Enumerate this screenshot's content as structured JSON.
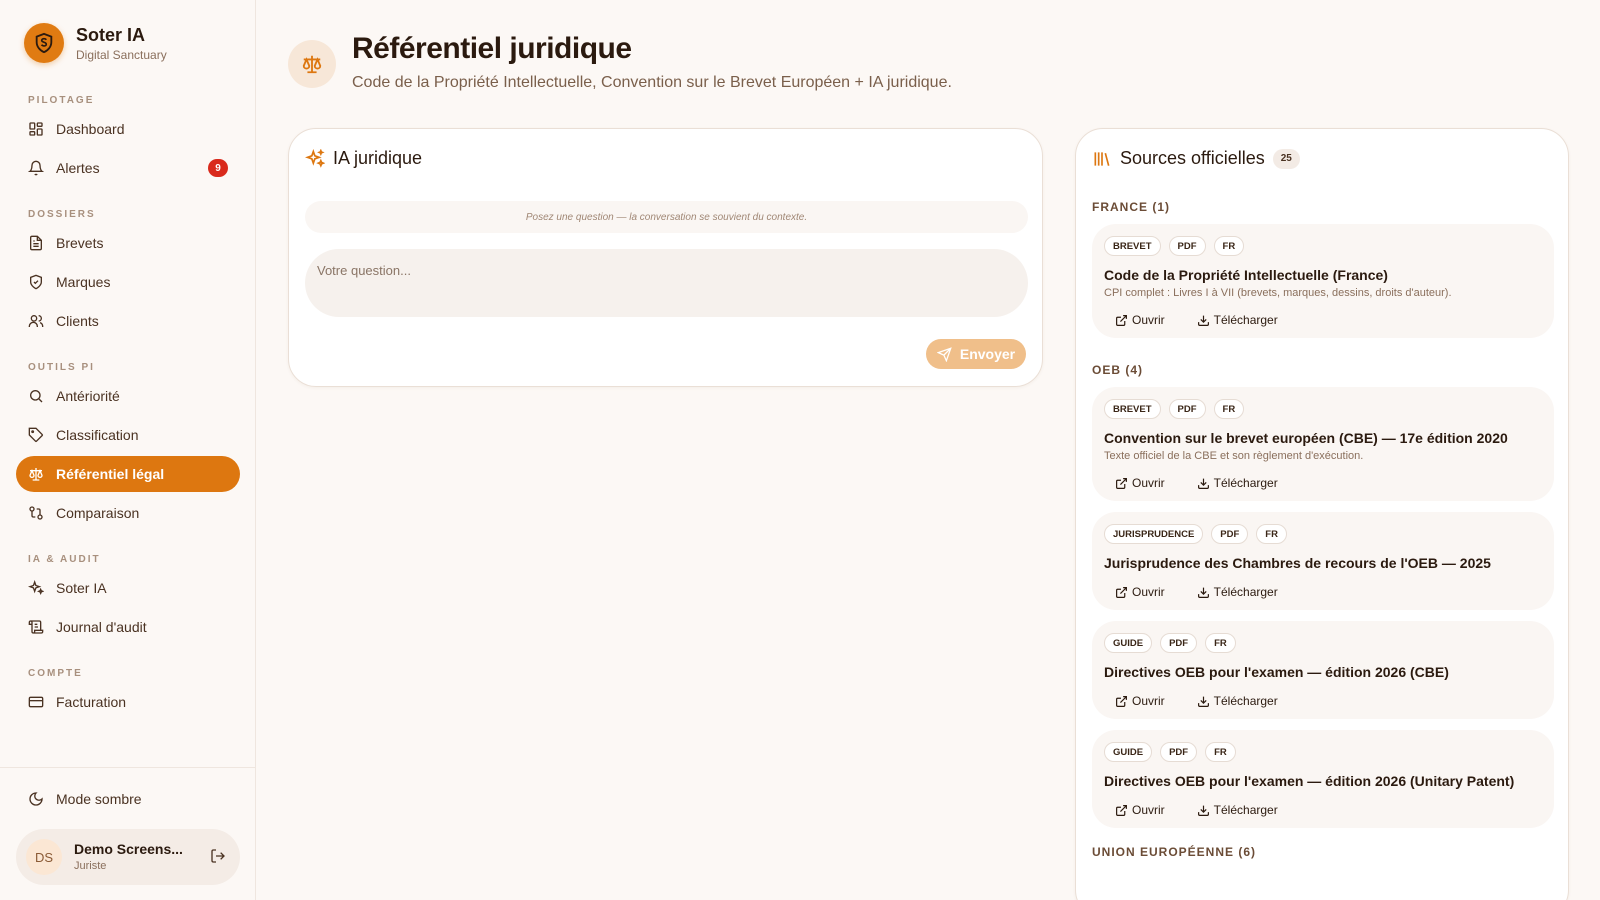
{
  "brand": {
    "name": "Soter IA",
    "subtitle": "Digital Sanctuary"
  },
  "nav": {
    "sections": [
      {
        "label": "PILOTAGE",
        "items": [
          {
            "label": "Dashboard",
            "icon": "dashboard-icon"
          },
          {
            "label": "Alertes",
            "icon": "bell-icon",
            "badge": "9"
          }
        ]
      },
      {
        "label": "DOSSIERS",
        "items": [
          {
            "label": "Brevets",
            "icon": "file-icon"
          },
          {
            "label": "Marques",
            "icon": "shield-icon"
          },
          {
            "label": "Clients",
            "icon": "users-icon"
          }
        ]
      },
      {
        "label": "OUTILS PI",
        "items": [
          {
            "label": "Antériorité",
            "icon": "search-icon"
          },
          {
            "label": "Classification",
            "icon": "tag-icon"
          },
          {
            "label": "Référentiel légal",
            "icon": "scales-icon",
            "active": true
          },
          {
            "label": "Comparaison",
            "icon": "compare-icon"
          }
        ]
      },
      {
        "label": "IA & AUDIT",
        "items": [
          {
            "label": "Soter IA",
            "icon": "sparkles-icon"
          },
          {
            "label": "Journal d'audit",
            "icon": "scroll-icon"
          }
        ]
      },
      {
        "label": "COMPTE",
        "items": [
          {
            "label": "Facturation",
            "icon": "credit-card-icon"
          }
        ]
      }
    ]
  },
  "sidebar_bottom": {
    "dark_mode_label": "Mode sombre",
    "user": {
      "initials": "DS",
      "name": "Demo Screens...",
      "role": "Juriste"
    }
  },
  "header": {
    "title": "Référentiel juridique",
    "subtitle": "Code de la Propriété Intellectuelle, Convention sur le Brevet Européen + IA juridique."
  },
  "ia_card": {
    "title": "IA juridique",
    "hint": "Posez une question — la conversation se souvient du contexte.",
    "placeholder": "Votre question...",
    "send_label": "Envoyer"
  },
  "sources": {
    "title": "Sources officielles",
    "count": "25",
    "open_label": "Ouvrir",
    "download_label": "Télécharger",
    "groups": [
      {
        "label": "FRANCE (1)",
        "docs": [
          {
            "tags": [
              "BREVET",
              "PDF",
              "FR"
            ],
            "title": "Code de la Propriété Intellectuelle (France)",
            "desc": "CPI complet : Livres I à VII (brevets, marques, dessins, droits d'auteur)."
          }
        ]
      },
      {
        "label": "OEB (4)",
        "docs": [
          {
            "tags": [
              "BREVET",
              "PDF",
              "FR"
            ],
            "title": "Convention sur le brevet européen (CBE) — 17e édition 2020",
            "desc": "Texte officiel de la CBE et son règlement d'exécution."
          },
          {
            "tags": [
              "JURISPRUDENCE",
              "PDF",
              "FR"
            ],
            "title": "Jurisprudence des Chambres de recours de l'OEB — 2025",
            "desc": ""
          },
          {
            "tags": [
              "GUIDE",
              "PDF",
              "FR"
            ],
            "title": "Directives OEB pour l'examen — édition 2026 (CBE)",
            "desc": ""
          },
          {
            "tags": [
              "GUIDE",
              "PDF",
              "FR"
            ],
            "title": "Directives OEB pour l'examen — édition 2026 (Unitary Patent)",
            "desc": ""
          }
        ]
      },
      {
        "label": "UNION EUROPÉENNE (6)",
        "docs": []
      }
    ]
  },
  "colors": {
    "accent": "#dd7710",
    "badge": "#d92a1c",
    "send_button": "#f0bf8a"
  }
}
